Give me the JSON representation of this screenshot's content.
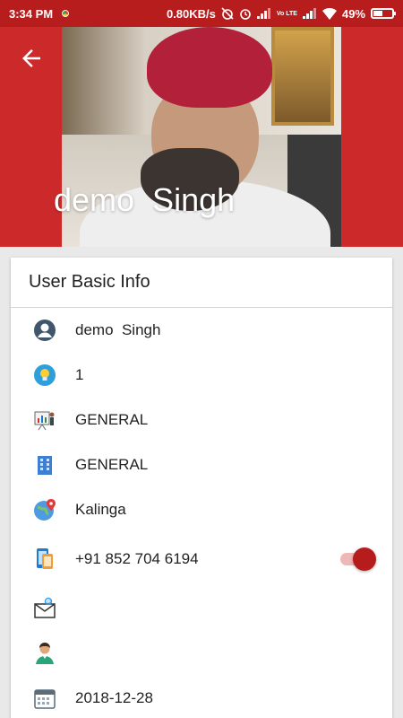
{
  "status_bar": {
    "time": "3:34 PM",
    "network_speed": "0.80KB/s",
    "volte": "Vo LTE",
    "battery_percent": "49%",
    "battery_level": 0.49,
    "icons": [
      "chrome-icon",
      "alarm-off-icon",
      "alarm-icon",
      "signal-icon",
      "volte-icon",
      "signal-icon",
      "wifi-icon",
      "battery-icon"
    ]
  },
  "header": {
    "back_icon": "back-arrow-icon",
    "name": "demo  Singh",
    "background_color": "#cc2a2a"
  },
  "card": {
    "title": "User Basic Info",
    "rows": [
      {
        "icon": "user-avatar-icon",
        "text": "demo  Singh"
      },
      {
        "icon": "lightbulb-icon",
        "text": "1"
      },
      {
        "icon": "presentation-icon",
        "text": "GENERAL"
      },
      {
        "icon": "office-building-icon",
        "text": "GENERAL"
      },
      {
        "icon": "globe-location-icon",
        "text": "Kalinga"
      },
      {
        "icon": "phone-icon",
        "text": "+91 852 704 6194",
        "toggle_on": true
      },
      {
        "icon": "email-icon",
        "text": ""
      },
      {
        "icon": "person-icon",
        "text": ""
      },
      {
        "icon": "calendar-icon",
        "text": "2018-12-28"
      }
    ]
  },
  "colors": {
    "accent": "#b71c1c",
    "toggle_track": "#f0b7b7"
  }
}
